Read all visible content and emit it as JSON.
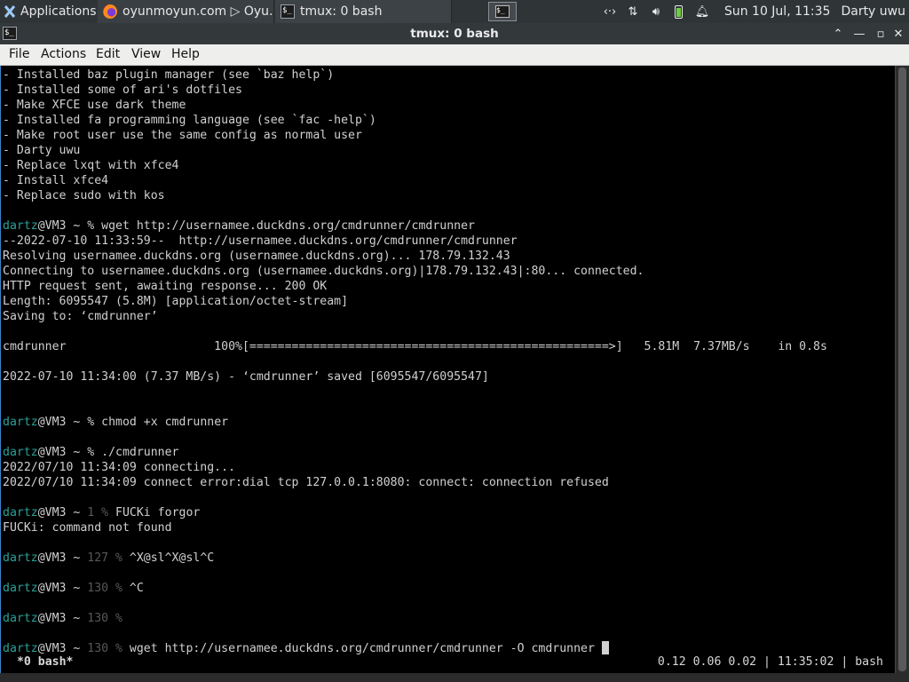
{
  "panel": {
    "applications": "Applications",
    "tasks": [
      {
        "label": "oyunmoyun.com ▷ Oyu...",
        "icon": "firefox-icon"
      },
      {
        "label": "tmux: 0 bash",
        "icon": "terminal-icon"
      }
    ],
    "clock": "Sun 10 Jul, 11:35",
    "user": "Darty uwu"
  },
  "window": {
    "title": "tmux: 0 bash",
    "menu": [
      "File",
      "Actions",
      "Edit",
      "View",
      "Help"
    ]
  },
  "terminal": {
    "lines": [
      {
        "text": "- Installed baz plugin manager (see `baz help`)"
      },
      {
        "text": "- Installed some of ari's dotfiles"
      },
      {
        "text": "- Make XFCE use dark theme"
      },
      {
        "text": "- Installed fa programming language (see `fac -help`)"
      },
      {
        "text": "- Make root user use the same config as normal user"
      },
      {
        "text": "- Darty uwu"
      },
      {
        "text": "- Replace lxqt with xfce4"
      },
      {
        "text": "- Install xfce4"
      },
      {
        "text": "- Replace sudo with kos"
      },
      {
        "text": ""
      },
      {
        "prompt": true,
        "user": "dartz",
        "host": "@VM3 ~ ",
        "code": "",
        "cmd": "% wget http://usernamee.duckdns.org/cmdrunner/cmdrunner"
      },
      {
        "text": "--2022-07-10 11:33:59--  http://usernamee.duckdns.org/cmdrunner/cmdrunner"
      },
      {
        "text": "Resolving usernamee.duckdns.org (usernamee.duckdns.org)... 178.79.132.43"
      },
      {
        "text": "Connecting to usernamee.duckdns.org (usernamee.duckdns.org)|178.79.132.43|:80... connected."
      },
      {
        "text": "HTTP request sent, awaiting response... 200 OK"
      },
      {
        "text": "Length: 6095547 (5.8M) [application/octet-stream]"
      },
      {
        "text": "Saving to: ‘cmdrunner’"
      },
      {
        "text": ""
      },
      {
        "text": "cmdrunner                     100%[===================================================>]   5.81M  7.37MB/s    in 0.8s"
      },
      {
        "text": ""
      },
      {
        "text": "2022-07-10 11:34:00 (7.37 MB/s) - ‘cmdrunner’ saved [6095547/6095547]"
      },
      {
        "text": ""
      },
      {
        "text": ""
      },
      {
        "prompt": true,
        "user": "dartz",
        "host": "@VM3 ~ ",
        "code": "",
        "cmd": "% chmod +x cmdrunner"
      },
      {
        "text": ""
      },
      {
        "prompt": true,
        "user": "dartz",
        "host": "@VM3 ~ ",
        "code": "",
        "cmd": "% ./cmdrunner"
      },
      {
        "text": "2022/07/10 11:34:09 connecting..."
      },
      {
        "text": "2022/07/10 11:34:09 connect error:dial tcp 127.0.0.1:8080: connect: connection refused"
      },
      {
        "text": ""
      },
      {
        "prompt": true,
        "user": "dartz",
        "host": "@VM3 ~ ",
        "code": "1 % ",
        "cmd": "FUCKi forgor"
      },
      {
        "text": "FUCKi: command not found"
      },
      {
        "text": ""
      },
      {
        "prompt": true,
        "user": "dartz",
        "host": "@VM3 ~ ",
        "code": "127 % ",
        "cmd": "^X@sl^X@sl^C"
      },
      {
        "text": ""
      },
      {
        "prompt": true,
        "user": "dartz",
        "host": "@VM3 ~ ",
        "code": "130 % ",
        "cmd": "^C"
      },
      {
        "text": ""
      },
      {
        "prompt": true,
        "user": "dartz",
        "host": "@VM3 ~ ",
        "code": "130 % ",
        "cmd": ""
      },
      {
        "text": ""
      },
      {
        "prompt": true,
        "cursor": true,
        "user": "dartz",
        "host": "@VM3 ~ ",
        "code": "130 % ",
        "cmd": "wget http://usernamee.duckdns.org/cmdrunner/cmdrunner -O cmdrunner "
      }
    ],
    "status_left": " *0 bash*",
    "status_right": "0.12 0.06 0.02 | 11:35:02 | bash"
  },
  "colors": {
    "prompt_user": "#2aa198",
    "exit_code": "#585858",
    "panel_bg": "#2f3437",
    "terminal_bg": "#000000"
  }
}
